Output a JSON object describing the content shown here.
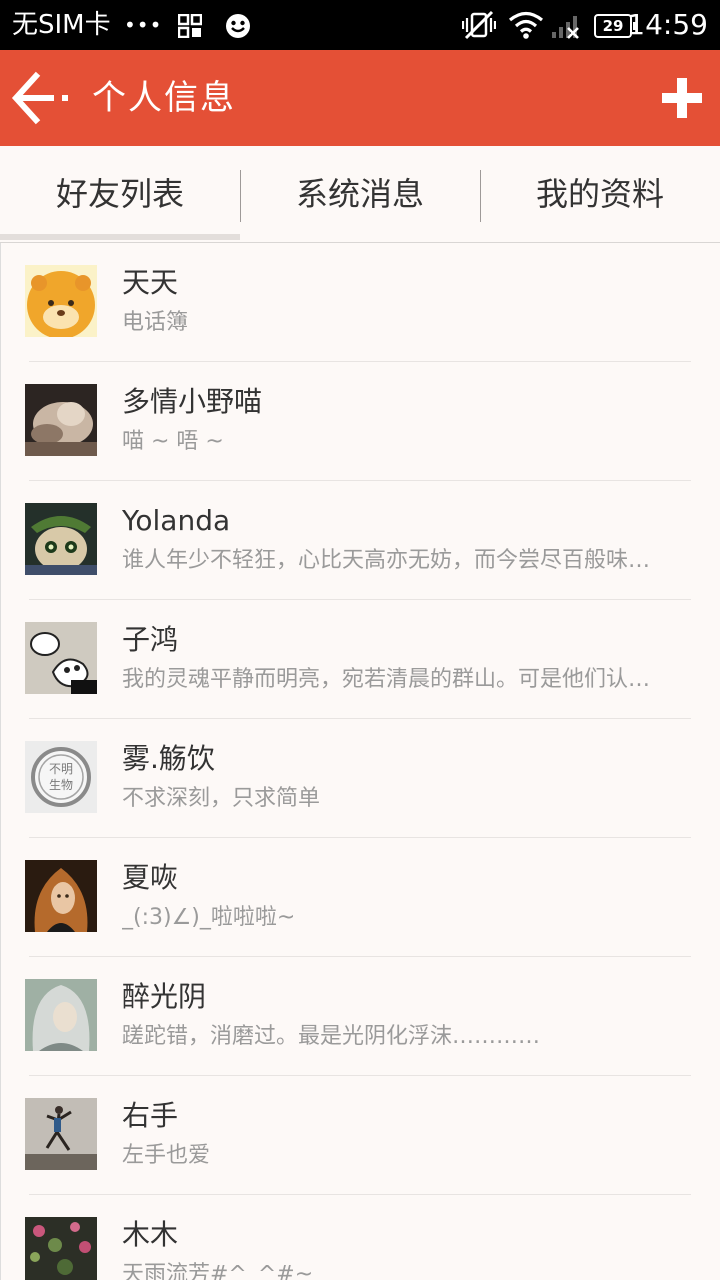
{
  "status_bar": {
    "carrier": "无SIM卡",
    "dots": "•••",
    "battery": "29",
    "time": "14:59"
  },
  "header": {
    "title": "个人信息",
    "back_icon": "arrow-left-icon",
    "add_icon": "plus-icon",
    "bg_color": "#e45036"
  },
  "tabs": [
    {
      "label": "好友列表",
      "selected": true
    },
    {
      "label": "系统消息",
      "selected": false
    },
    {
      "label": "我的资料",
      "selected": false
    }
  ],
  "friends": [
    {
      "name": "天天",
      "status": "电话簿"
    },
    {
      "name": "多情小野喵",
      "status": "喵 ~ 唔 ~"
    },
    {
      "name": "Yolanda",
      "status": "谁人年少不轻狂，心比天高亦无妨，而今尝尽百般味…"
    },
    {
      "name": "子鸿",
      "status": "我的灵魂平静而明亮，宛若清晨的群山。可是他们认…"
    },
    {
      "name": "雾.觞饮",
      "status": "不求深刻，只求简单",
      "avatar_text": "不明生物"
    },
    {
      "name": "夏咴",
      "status": "_(:3)∠)_啦啦啦~"
    },
    {
      "name": "醉光阴",
      "status": "蹉跎错，消磨过。最是光阴化浮沫…………"
    },
    {
      "name": "右手",
      "status": "左手也爱"
    },
    {
      "name": "木木",
      "status": "天雨流芳#^_^#~"
    }
  ]
}
